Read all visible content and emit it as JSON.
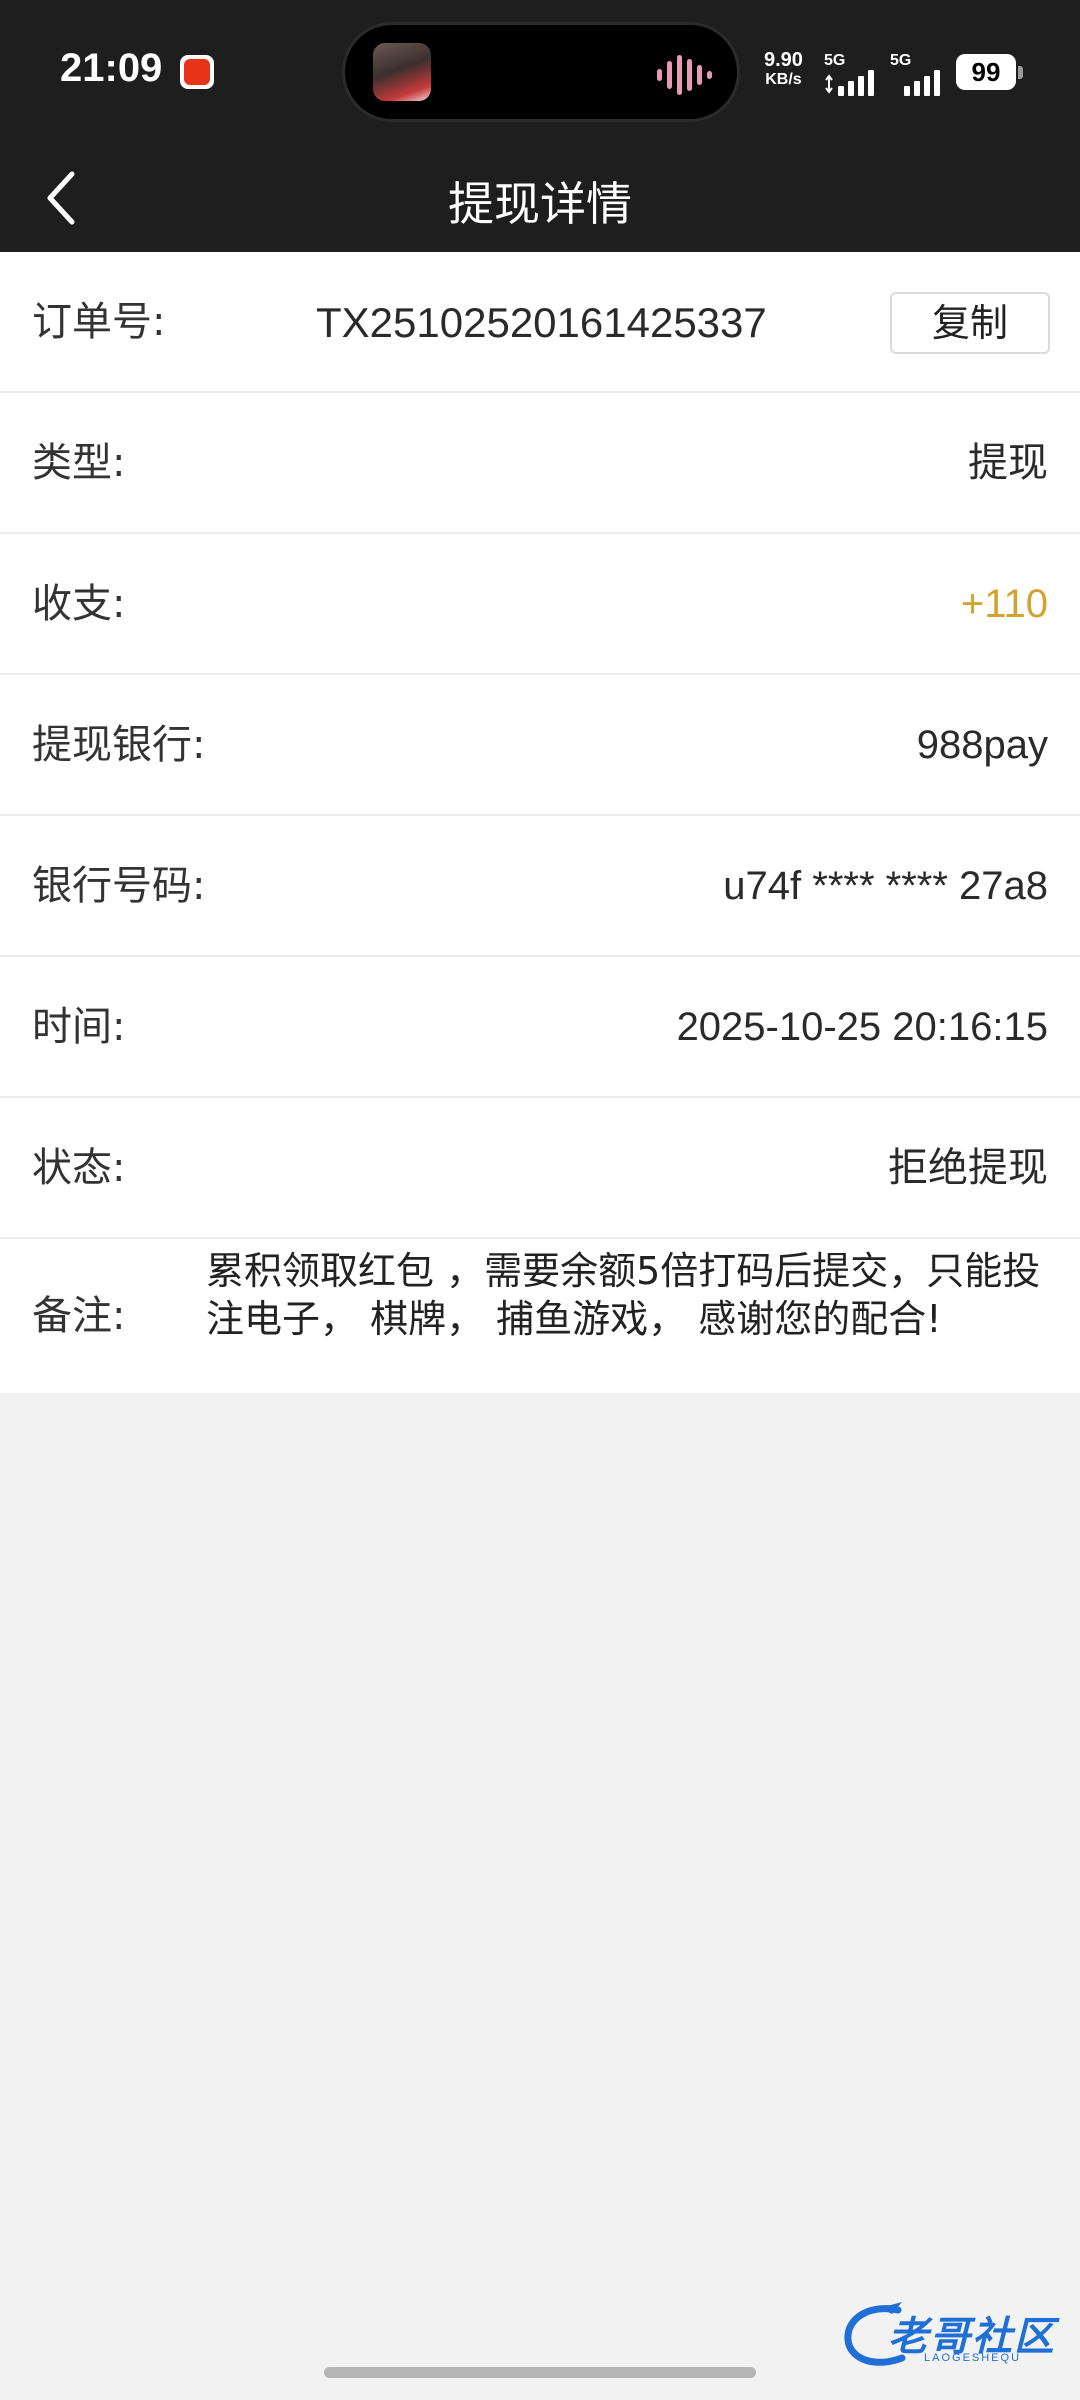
{
  "status_bar": {
    "time": "21:09",
    "net_speed": "9.90",
    "net_speed_unit": "KB/s",
    "signal1_label": "5G",
    "signal2_label": "5G",
    "battery": "99",
    "icons": [
      "app-notification-icon",
      "audio-wave-icon",
      "signal-icon",
      "battery-icon"
    ]
  },
  "nav": {
    "title": "提现详情",
    "back_icon": "chevron-left-icon"
  },
  "details": {
    "order": {
      "label": "订单号:",
      "value": "TX25102520161425337",
      "copy_label": "复制"
    },
    "type": {
      "label": "类型:",
      "value": "提现"
    },
    "amount": {
      "label": "收支:",
      "value": "+110",
      "color": "#d4a22f"
    },
    "bank": {
      "label": "提现银行:",
      "value": "988pay"
    },
    "account": {
      "label": "银行号码:",
      "value": "u74f **** **** 27a8"
    },
    "time": {
      "label": "时间:",
      "value": "2025-10-25 20:16:15"
    },
    "status": {
      "label": "状态:",
      "value": "拒绝提现"
    },
    "remark": {
      "label": "备注:",
      "value": "累积领取红包 ，需要余额5倍打码后提交，只能投注电子， 棋牌， 捕鱼游戏， 感谢您的配合!"
    }
  },
  "watermark": {
    "text": "老哥社区",
    "sub": "LAOGESHEQU"
  },
  "colors": {
    "header_bg": "#1e1e1e",
    "page_bg": "#f2f2f2",
    "accent_amount": "#d4a22f"
  }
}
